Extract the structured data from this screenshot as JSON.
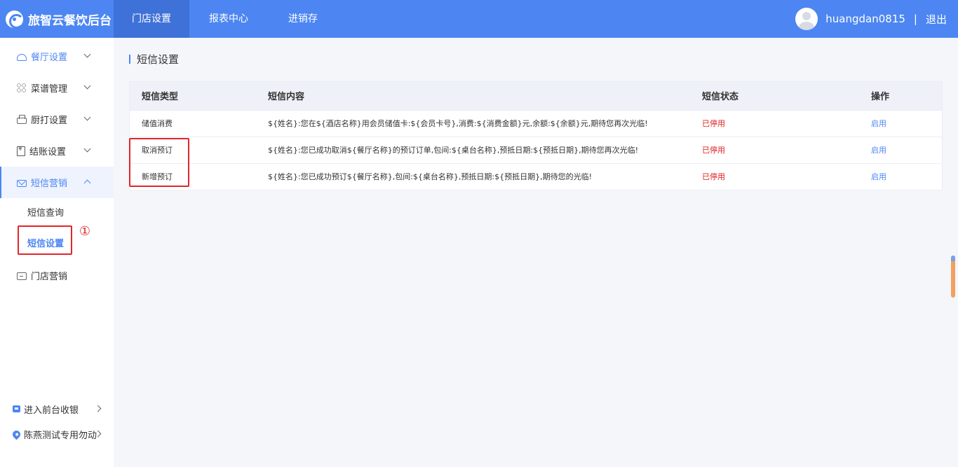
{
  "header": {
    "brand": "旅智云餐饮后台",
    "nav": [
      "门店设置",
      "报表中心",
      "进销存"
    ],
    "username": "huangdan0815",
    "separator": "|",
    "logout": "退出"
  },
  "sidebar": {
    "items": [
      {
        "label": "餐厅设置",
        "icon": "bell-icon"
      },
      {
        "label": "菜谱管理",
        "icon": "grid-icon"
      },
      {
        "label": "厨打设置",
        "icon": "printer-icon"
      },
      {
        "label": "结账设置",
        "icon": "bill-icon"
      },
      {
        "label": "短信营销",
        "icon": "mail-icon"
      }
    ],
    "sub_items": [
      "短信查询",
      "短信设置"
    ],
    "store_marketing": "门店营销",
    "bottom": {
      "cashier": "进入前台收银",
      "store": "陈燕测试专用勿动"
    }
  },
  "page": {
    "title": "短信设置",
    "columns": [
      "短信类型",
      "短信内容",
      "短信状态",
      "操作"
    ],
    "rows": [
      {
        "type": "储值消费",
        "content": "${姓名}:您在${酒店名称}用会员储值卡:${会员卡号},消费:${消费金额}元,余额:${余额}元,期待您再次光临!",
        "status": "已停用",
        "action": "启用"
      },
      {
        "type": "取消预订",
        "content": "${姓名}:您已成功取消${餐厅名称}的预订订单,包间:${桌台名称},预抵日期:${预抵日期},期待您再次光临!",
        "status": "已停用",
        "action": "启用"
      },
      {
        "type": "新增预订",
        "content": "${姓名}:您已成功预订${餐厅名称},包间:${桌台名称},预抵日期:${预抵日期},期待您的光临!",
        "status": "已停用",
        "action": "启用"
      }
    ]
  },
  "annotation": {
    "marker": "①"
  },
  "colors": {
    "primary": "#4d86f2",
    "danger": "#e02020",
    "annotation": "#e0262b"
  }
}
